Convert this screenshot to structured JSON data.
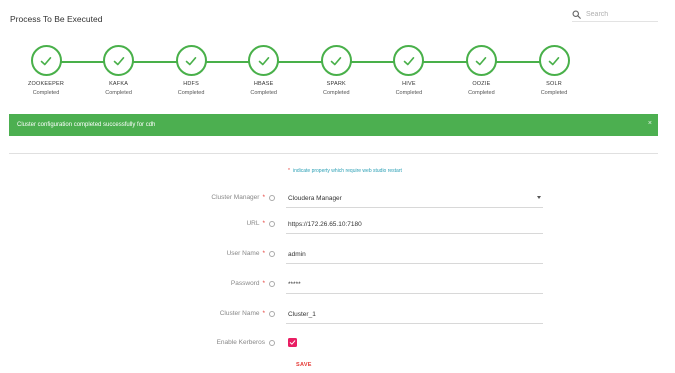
{
  "header": {
    "title": "Process To Be Executed",
    "search_placeholder": "Search"
  },
  "steps": [
    {
      "name": "ZOOKEEPER",
      "status": "Completed"
    },
    {
      "name": "KAFKA",
      "status": "Completed"
    },
    {
      "name": "HDFS",
      "status": "Completed"
    },
    {
      "name": "HBASE",
      "status": "Completed"
    },
    {
      "name": "SPARK",
      "status": "Completed"
    },
    {
      "name": "HIVE",
      "status": "Completed"
    },
    {
      "name": "OOZIE",
      "status": "Completed"
    },
    {
      "name": "SOLR",
      "status": "Completed"
    }
  ],
  "banner": {
    "message": "Cluster configuration completed successfully for cdh",
    "close": "×"
  },
  "note": {
    "star": "*",
    "text": "indicate property which require web studio restart"
  },
  "form": {
    "cluster_manager": {
      "label": "Cluster Manager",
      "value": "Cloudera Manager"
    },
    "url": {
      "label": "URL",
      "value": "https://172.26.65.10:7180"
    },
    "user_name": {
      "label": "User Name",
      "value": "admin"
    },
    "password": {
      "label": "Password",
      "value": "*****"
    },
    "cluster_name": {
      "label": "Cluster Name",
      "value": "Cluster_1"
    },
    "enable_kerberos": {
      "label": "Enable Kerberos",
      "checked": true
    },
    "required_mark": "*"
  },
  "save_label": "SAVE",
  "colors": {
    "accent_green": "#49b04a",
    "banner_green": "#4caf50",
    "required_red": "#e53935",
    "checkbox_pink": "#e91e63",
    "note_teal": "#2a9fb5"
  }
}
